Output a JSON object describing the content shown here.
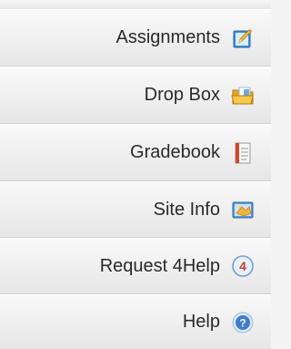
{
  "menu": {
    "items": [
      {
        "label": "Assignments",
        "icon": "assignments-pencil-icon"
      },
      {
        "label": "Drop Box",
        "icon": "drop-box-folder-icon"
      },
      {
        "label": "Gradebook",
        "icon": "gradebook-notebook-icon"
      },
      {
        "label": "Site Info",
        "icon": "site-info-icon"
      },
      {
        "label": "Request 4Help",
        "icon": "request-4help-icon",
        "icon_text": "4"
      },
      {
        "label": "Help",
        "icon": "help-icon",
        "icon_text": "?"
      }
    ]
  }
}
